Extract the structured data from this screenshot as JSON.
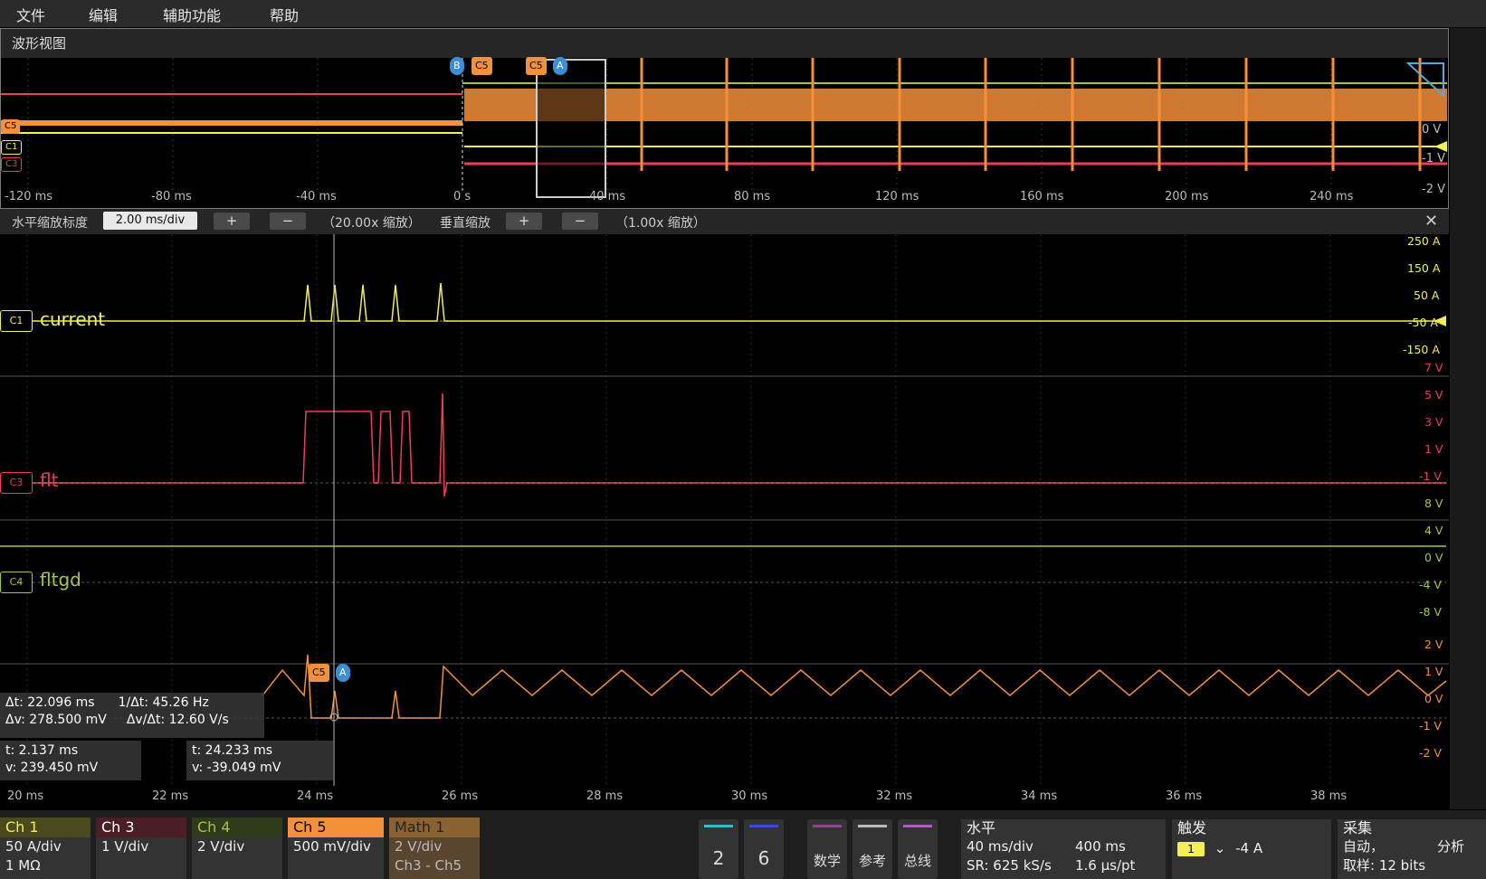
{
  "menu": [
    "文件",
    "编辑",
    "辅助功能",
    "帮助"
  ],
  "overview": {
    "title": "波形视图",
    "time_ticks": [
      "-120 ms",
      "-80 ms",
      "-40 ms",
      "0 s",
      "40 ms",
      "80 ms",
      "120 ms",
      "160 ms",
      "200 ms",
      "240 ms"
    ],
    "volt_ticks": [
      "0 V",
      "-1 V",
      "-2 V"
    ],
    "markers": {
      "b": "B",
      "c5_left": "C5",
      "c5_right": "C5",
      "a": "A"
    },
    "tags": {
      "c5": "C5",
      "c1": "C1",
      "c3": "C3"
    }
  },
  "zoom": {
    "h_label": "水平缩放标度",
    "h_value": "2.00 ms/div",
    "h_factor": "（20.00x 缩放）",
    "v_label": "垂直缩放",
    "v_factor": "（1.00x 缩放）",
    "plus": "+",
    "minus": "−",
    "close": "✕"
  },
  "channels": {
    "c1": {
      "tag": "C1",
      "name": "current",
      "scale": [
        "250 A",
        "150 A",
        "50 A",
        "-50 A",
        "-150 A"
      ],
      "color": "#f2ee58"
    },
    "c3": {
      "tag": "C3",
      "name": "flt",
      "scale": [
        "7 V",
        "5 V",
        "3 V",
        "1 V",
        "-1 V"
      ],
      "color": "#ee3d5c"
    },
    "c4": {
      "tag": "C4",
      "name": "fltgd",
      "scale": [
        "8 V",
        "4 V",
        "0 V",
        "-4 V",
        "-8 V"
      ],
      "color": "#a5c83a"
    },
    "m1": {
      "scale": [
        "2 V",
        "1 V",
        "0 V",
        "-1 V",
        "-2 V"
      ],
      "color": "#f2913a"
    }
  },
  "main_time_ticks": [
    "20 ms",
    "22 ms",
    "24 ms",
    "26 ms",
    "28 ms",
    "30 ms",
    "32 ms",
    "34 ms",
    "36 ms",
    "38 ms"
  ],
  "cursor_markers": {
    "c5": "C5",
    "a": "A"
  },
  "readouts": {
    "dt": "Δt: 22.096 ms",
    "inv_dt": "1/Δt: 45.26 Hz",
    "dv": "Δv: 278.500 mV",
    "dvdt": "Δv/Δt: 12.60 V/s",
    "c1_t": "t: 2.137 ms",
    "c1_v": "v: 239.450 mV",
    "c2_t": "t: 24.233 ms",
    "c2_v": "v: -39.049 mV"
  },
  "bottom": {
    "ch1": {
      "title": "Ch 1",
      "l1": "50 A/div",
      "l2": "1 MΩ",
      "color": "#f2ee58"
    },
    "ch3": {
      "title": "Ch 3",
      "l1": "1 V/div",
      "color": "#ee3d5c"
    },
    "ch4": {
      "title": "Ch 4",
      "l1": "2 V/div",
      "color": "#a5c83a"
    },
    "ch5": {
      "title": "Ch 5",
      "l1": "500 mV/div",
      "color": "#f2913a"
    },
    "math1": {
      "title": "Math 1",
      "l1": "2 V/div",
      "l2": "Ch3 - Ch5"
    },
    "btn2": "2",
    "btn6": "6",
    "math_btn": "数学",
    "ref_btn": "参考",
    "bus_btn": "总线",
    "horizontal": {
      "title": "水平",
      "div": "40 ms/div",
      "len": "400 ms",
      "sr": "SR: 625 kS/s",
      "pt": "1.6 μs/pt"
    },
    "trigger": {
      "title": "触发",
      "src": "1",
      "level": "-4 A"
    },
    "acq": {
      "title": "采集",
      "mode": "自动，",
      "analyze": "分析",
      "bits": "取样: 12 bits"
    }
  }
}
